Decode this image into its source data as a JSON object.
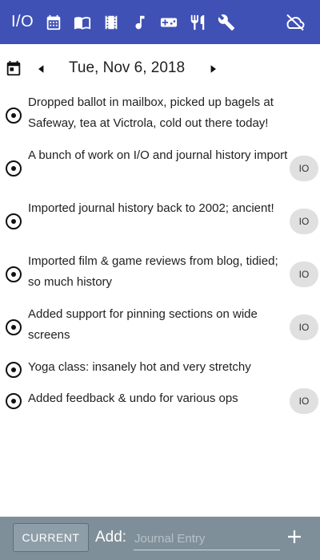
{
  "appbar": {
    "brand": "I/O",
    "tabs": [
      {
        "icon": "calendar-icon"
      },
      {
        "icon": "book-icon"
      },
      {
        "icon": "film-icon"
      },
      {
        "icon": "music-note-icon"
      },
      {
        "icon": "gamepad-icon"
      },
      {
        "icon": "fork-knife-icon"
      },
      {
        "icon": "wrench-icon"
      }
    ],
    "sync_icon": "cloud-off-icon",
    "color": "#3f51b5"
  },
  "datebar": {
    "date": "Tue, Nov 6, 2018",
    "calendar_icon": "calendar-icon",
    "prev_icon": "arrow-left-icon",
    "next_icon": "arrow-right-icon"
  },
  "entries": [
    {
      "text": "Dropped ballot in mailbox, picked up bagels at Safeway, tea at Victrola, cold out there today!",
      "badge": ""
    },
    {
      "text": "A bunch of work on I/O and journal history import",
      "badge": "IO"
    },
    {
      "text": "Imported journal history back to 2002; ancient!",
      "badge": "IO"
    },
    {
      "text": "Imported film & game reviews from blog, tidied; so much history",
      "badge": "IO"
    },
    {
      "text": "Added support for pinning sections on wide screens",
      "badge": "IO"
    },
    {
      "text": "Yoga class: insanely hot and very stretchy",
      "badge": ""
    },
    {
      "text": "Added feedback & undo for various ops",
      "badge": "IO"
    }
  ],
  "bottombar": {
    "current_label": "CURRENT",
    "add_label": "Add:",
    "input_placeholder": "Journal Entry",
    "input_value": "",
    "color": "#7f8f99"
  }
}
